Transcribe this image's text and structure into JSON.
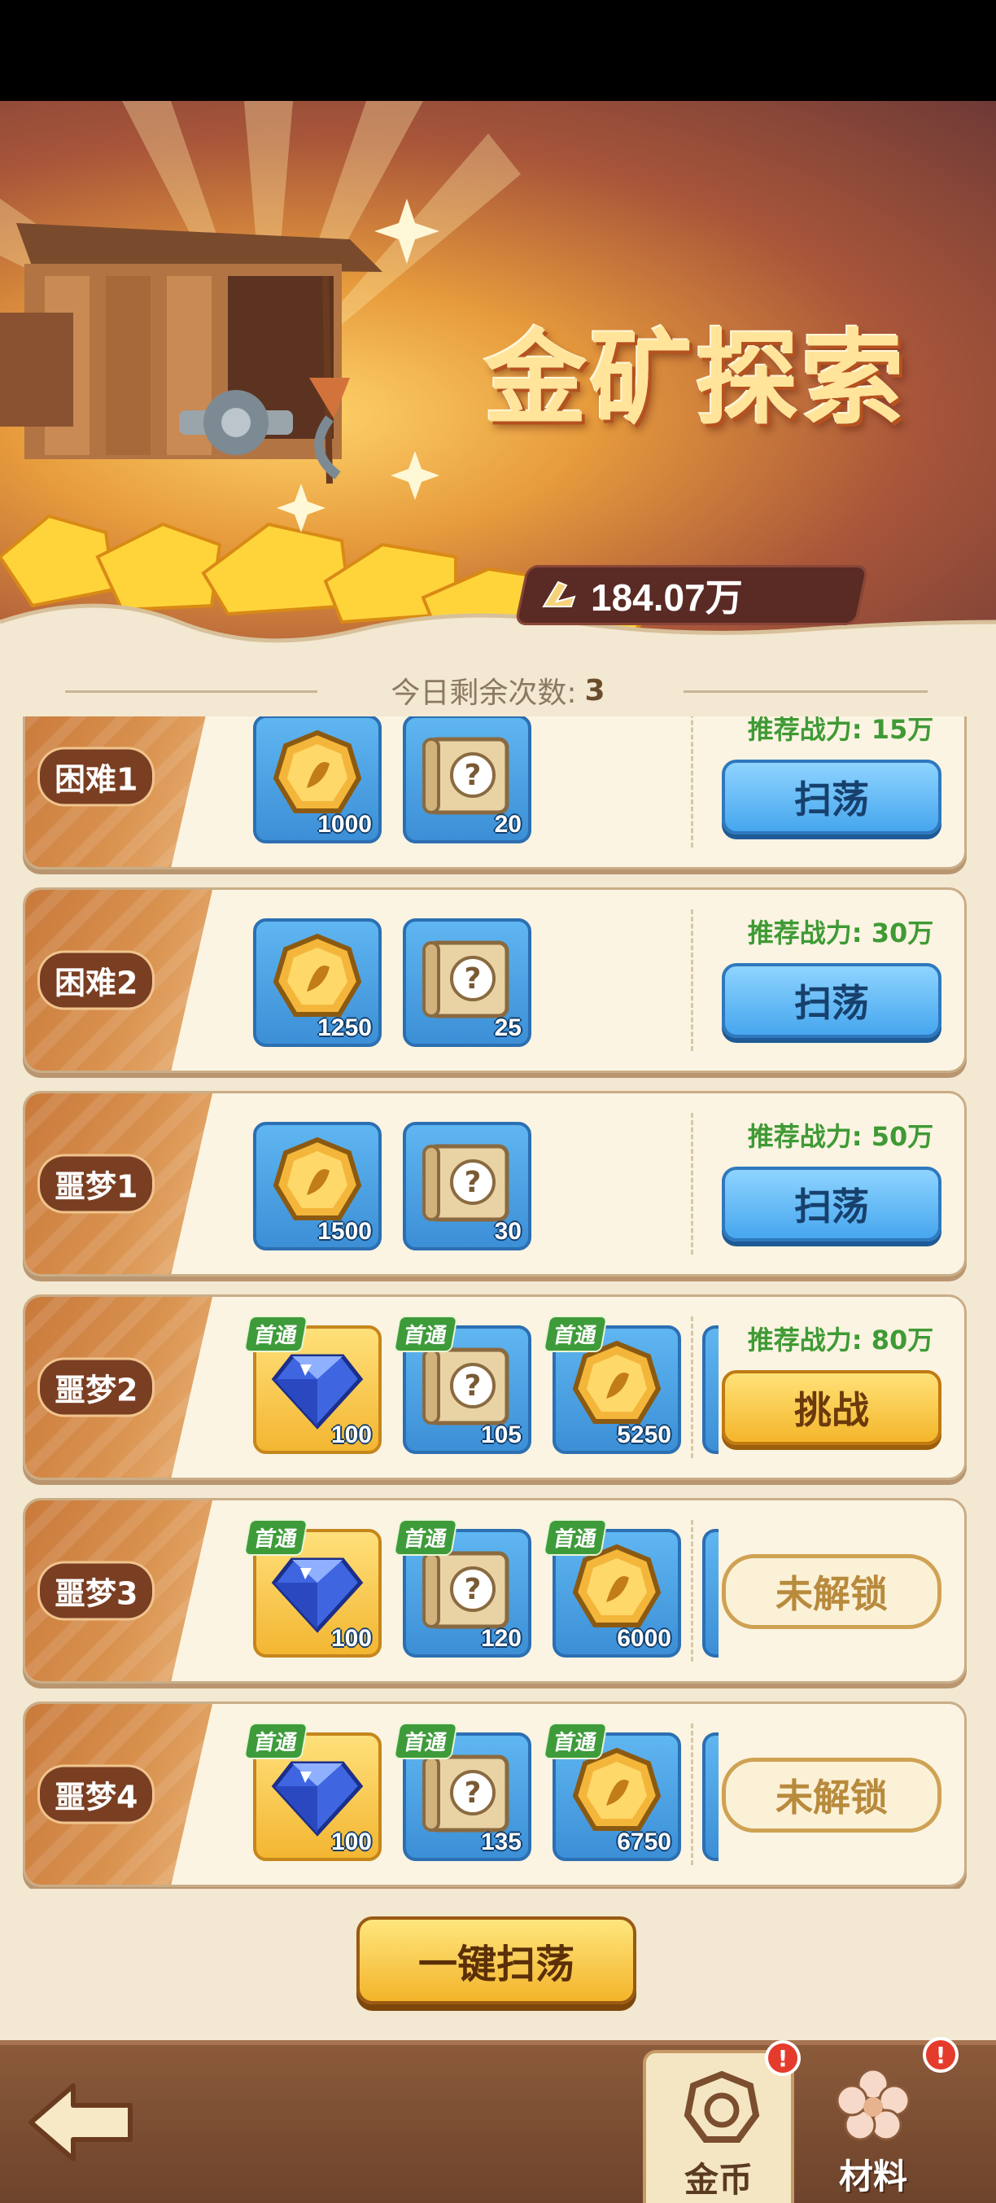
{
  "banner": {
    "title": "金矿探索",
    "power": "184.07万",
    "colors": {
      "accent": "#ffe49a",
      "shadow": "#b5521f"
    }
  },
  "remaining": {
    "label": "今日剩余次数:",
    "count": "3"
  },
  "levels": [
    {
      "label": "困难1",
      "requirement": "推荐战力: 15万",
      "items": [
        {
          "type": "coin",
          "count": "1000",
          "first": false
        },
        {
          "type": "scroll",
          "count": "20",
          "first": false
        }
      ],
      "action": "扫荡",
      "action_type": "sweep"
    },
    {
      "label": "困难2",
      "requirement": "推荐战力: 30万",
      "items": [
        {
          "type": "coin",
          "count": "1250",
          "first": false
        },
        {
          "type": "scroll",
          "count": "25",
          "first": false
        }
      ],
      "action": "扫荡",
      "action_type": "sweep"
    },
    {
      "label": "噩梦1",
      "requirement": "推荐战力: 50万",
      "items": [
        {
          "type": "coin",
          "count": "1500",
          "first": false
        },
        {
          "type": "scroll",
          "count": "30",
          "first": false
        }
      ],
      "action": "扫荡",
      "action_type": "sweep"
    },
    {
      "label": "噩梦2",
      "requirement": "推荐战力: 80万",
      "items": [
        {
          "type": "diamond",
          "count": "100",
          "first": true
        },
        {
          "type": "scroll",
          "count": "105",
          "first": true
        },
        {
          "type": "coin",
          "count": "5250",
          "first": true
        }
      ],
      "action": "挑战",
      "action_type": "challenge"
    },
    {
      "label": "噩梦3",
      "requirement": "",
      "items": [
        {
          "type": "diamond",
          "count": "100",
          "first": true
        },
        {
          "type": "scroll",
          "count": "120",
          "first": true
        },
        {
          "type": "coin",
          "count": "6000",
          "first": true
        }
      ],
      "action": "未解锁",
      "action_type": "locked"
    },
    {
      "label": "噩梦4",
      "requirement": "",
      "items": [
        {
          "type": "diamond",
          "count": "100",
          "first": true
        },
        {
          "type": "scroll",
          "count": "135",
          "first": true
        },
        {
          "type": "coin",
          "count": "6750",
          "first": true
        }
      ],
      "action": "未解锁",
      "action_type": "locked"
    }
  ],
  "first_clear_label": "首通",
  "one_click_sweep": "一键扫荡",
  "nav": {
    "tabs": [
      {
        "label": "金币",
        "active": true,
        "badge": "!"
      },
      {
        "label": "材料",
        "active": false,
        "badge": "!"
      }
    ]
  }
}
